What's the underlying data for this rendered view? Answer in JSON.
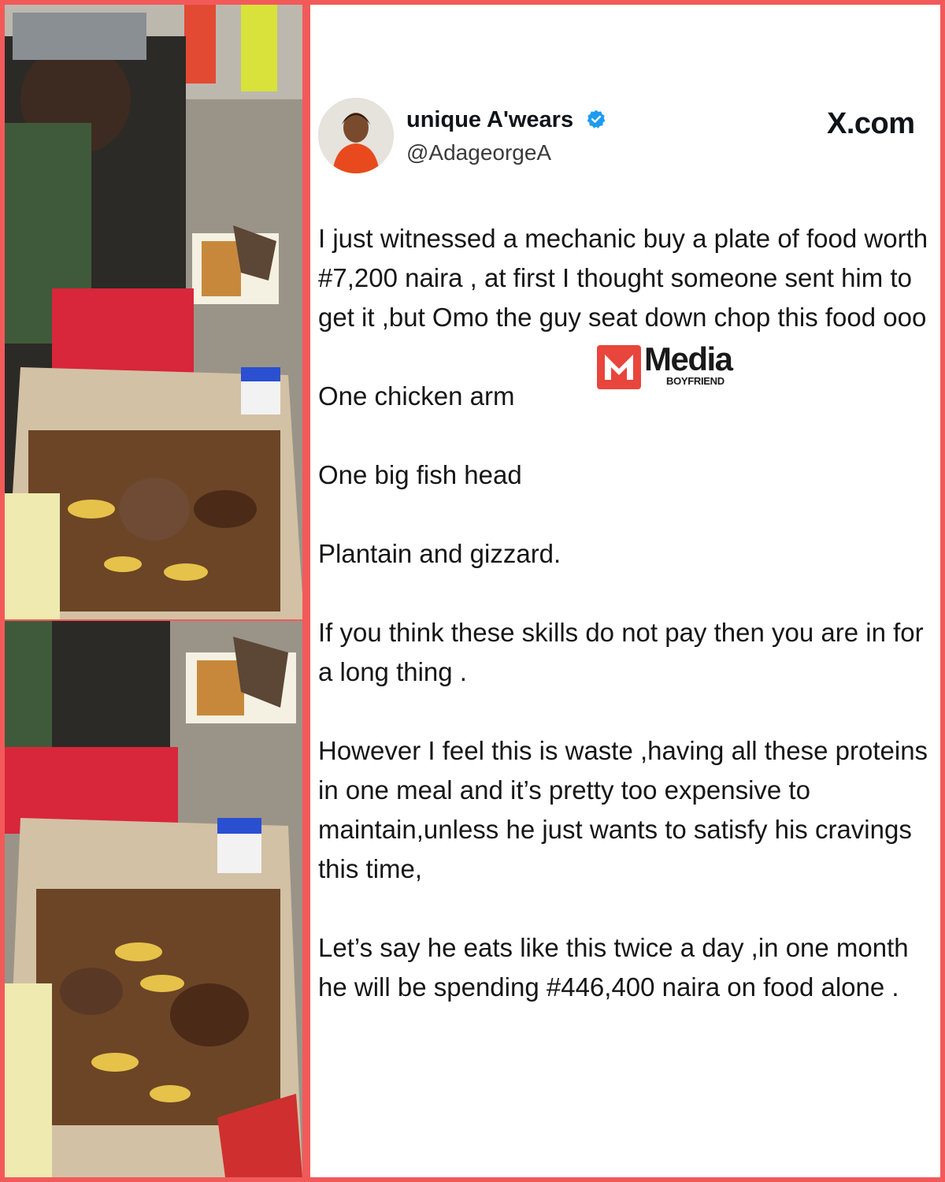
{
  "post": {
    "display_name": "unique A'wears",
    "handle": "@AdageorgeA",
    "site": "X.com",
    "paragraphs": [
      "I just witnessed a mechanic buy a plate of food worth #7,200 naira  , at first I thought someone sent him to get it ,but Omo the guy seat down chop this food ooo",
      "One chicken arm",
      "One big fish head",
      "Plantain and gizzard.",
      "If you think these skills do not pay then you are in for a long thing .",
      "However I feel this is waste ,having all these proteins in one meal and it’s pretty too expensive to maintain,unless he just wants to satisfy his cravings this time,",
      "Let’s say he eats like this twice a day ,in one month he will be spending #446,400 naira on food alone ."
    ]
  },
  "watermark": {
    "brand": "Media",
    "sub": "BOYFRIEND"
  },
  "colors": {
    "frame": "#f25a5a",
    "verified": "#1d9bf0",
    "watermark_red": "#e8453c"
  },
  "icons": [
    "verified-badge-icon",
    "media-boyfriend-logo"
  ]
}
